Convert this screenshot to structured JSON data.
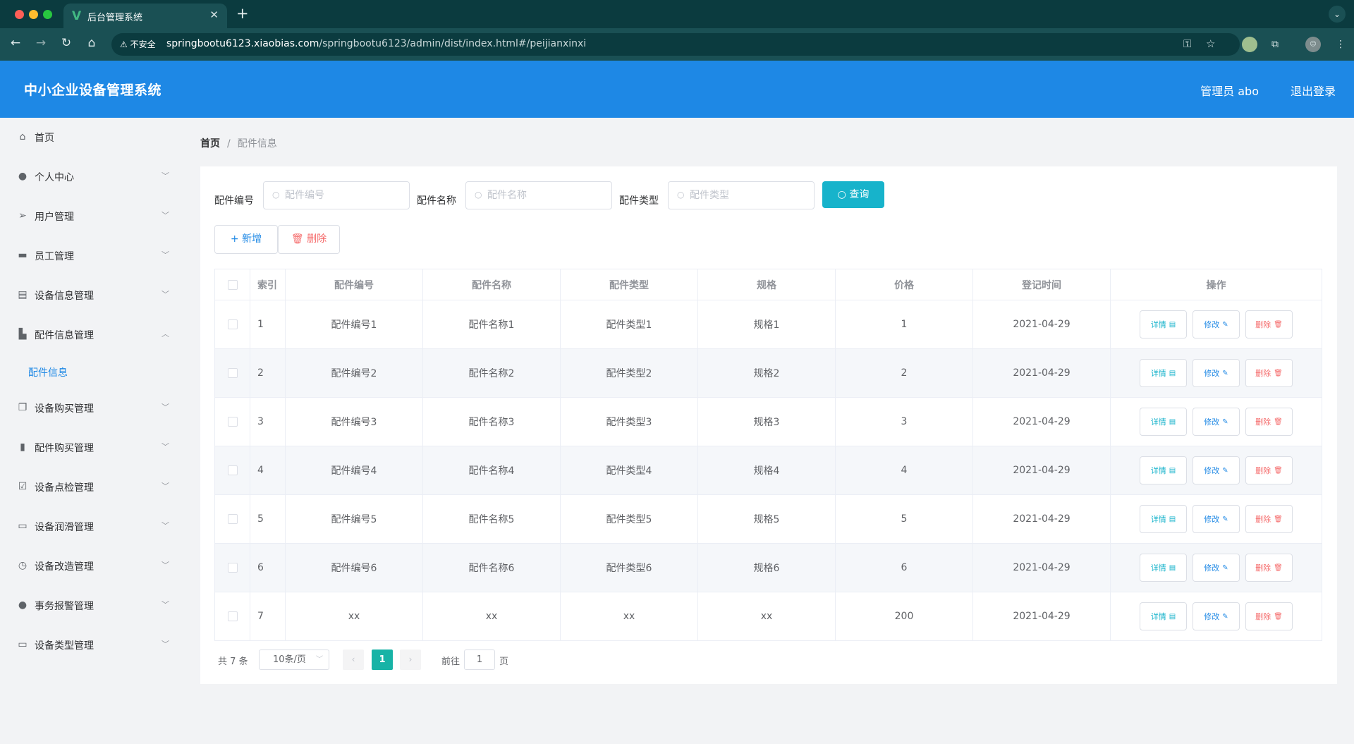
{
  "browser": {
    "tab_title": "后台管理系统",
    "tab_logo": "V",
    "security_label": "不安全",
    "url_host": "springbootu6123.xiaobias.com",
    "url_path": "/springbootu6123/admin/dist/index.html#/peijianxinxi"
  },
  "header": {
    "title": "中小企业设备管理系统",
    "user": "管理员 abo",
    "logout": "退出登录",
    "bg_color": "#1e88e5"
  },
  "sidebar": {
    "items": [
      {
        "label": "首页",
        "icon": "home-icon"
      },
      {
        "label": "个人中心",
        "icon": "user-icon"
      },
      {
        "label": "用户管理",
        "icon": "send-icon"
      },
      {
        "label": "员工管理",
        "icon": "monitor-icon"
      },
      {
        "label": "设备信息管理",
        "icon": "clipboard-icon"
      },
      {
        "label": "配件信息管理",
        "icon": "shop-icon"
      },
      {
        "label": "设备购买管理",
        "icon": "copy-icon"
      },
      {
        "label": "配件购买管理",
        "icon": "bar-chart-icon"
      },
      {
        "label": "设备点检管理",
        "icon": "checklist-icon"
      },
      {
        "label": "设备润滑管理",
        "icon": "chat-icon"
      },
      {
        "label": "设备改造管理",
        "icon": "compass-icon"
      },
      {
        "label": "事务报警管理",
        "icon": "person-icon"
      },
      {
        "label": "设备类型管理",
        "icon": "postcard-icon"
      }
    ],
    "sub_item": "配件信息"
  },
  "breadcrumb": {
    "home": "首页",
    "separator": "/",
    "current": "配件信息"
  },
  "search": {
    "fields": [
      {
        "label": "配件编号",
        "placeholder": "配件编号"
      },
      {
        "label": "配件名称",
        "placeholder": "配件名称"
      },
      {
        "label": "配件类型",
        "placeholder": "配件类型"
      }
    ],
    "query_button": "查询"
  },
  "actions": {
    "add": "新增",
    "delete": "删除"
  },
  "table": {
    "columns": [
      "索引",
      "配件编号",
      "配件名称",
      "配件类型",
      "规格",
      "价格",
      "登记时间",
      "操作"
    ],
    "rows": [
      {
        "index": "1",
        "code": "配件编号1",
        "name": "配件名称1",
        "type": "配件类型1",
        "spec": "规格1",
        "price": "1",
        "date": "2021-04-29"
      },
      {
        "index": "2",
        "code": "配件编号2",
        "name": "配件名称2",
        "type": "配件类型2",
        "spec": "规格2",
        "price": "2",
        "date": "2021-04-29"
      },
      {
        "index": "3",
        "code": "配件编号3",
        "name": "配件名称3",
        "type": "配件类型3",
        "spec": "规格3",
        "price": "3",
        "date": "2021-04-29"
      },
      {
        "index": "4",
        "code": "配件编号4",
        "name": "配件名称4",
        "type": "配件类型4",
        "spec": "规格4",
        "price": "4",
        "date": "2021-04-29"
      },
      {
        "index": "5",
        "code": "配件编号5",
        "name": "配件名称5",
        "type": "配件类型5",
        "spec": "规格5",
        "price": "5",
        "date": "2021-04-29"
      },
      {
        "index": "6",
        "code": "配件编号6",
        "name": "配件名称6",
        "type": "配件类型6",
        "spec": "规格6",
        "price": "6",
        "date": "2021-04-29"
      },
      {
        "index": "7",
        "code": "xx",
        "name": "xx",
        "type": "xx",
        "spec": "xx",
        "price": "200",
        "date": "2021-04-29"
      }
    ],
    "row_actions": {
      "detail": "详情",
      "edit": "修改",
      "delete": "删除"
    }
  },
  "pagination": {
    "total": "共 7 条",
    "page_size": "10条/页",
    "current_page": "1",
    "goto_label": "前往",
    "goto_value": "1",
    "page_suffix": "页"
  },
  "colors": {
    "accent": "#1e88e5",
    "query": "#17b3cb",
    "danger": "#f56c6c",
    "page_active": "#17b3a6"
  }
}
